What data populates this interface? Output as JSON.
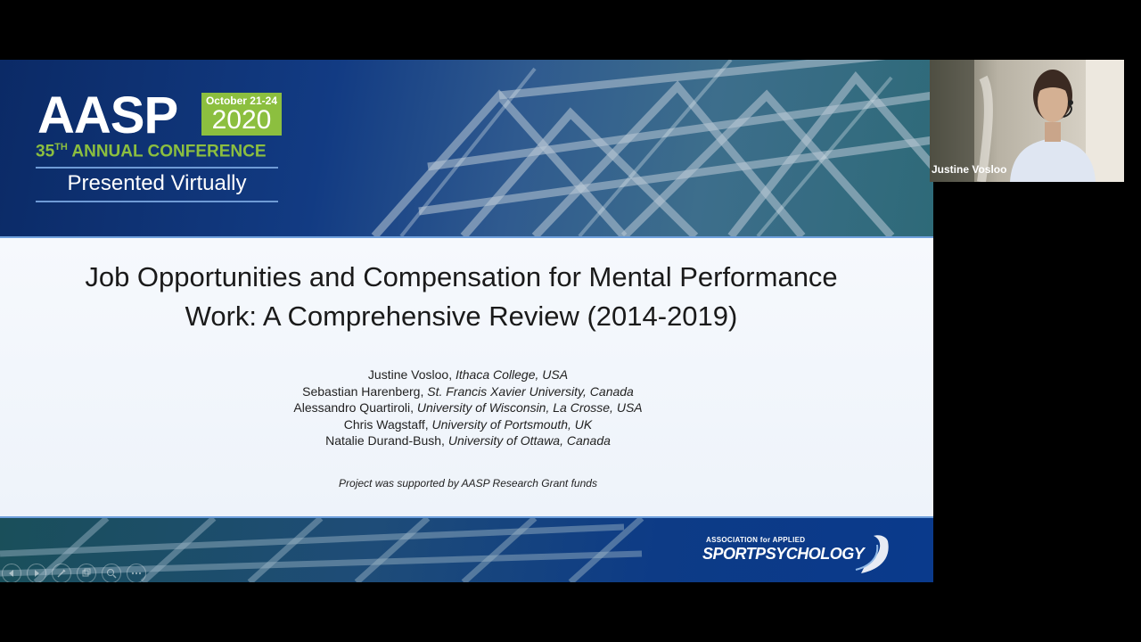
{
  "conference": {
    "org": "AASP",
    "dates": "October 21-24",
    "year": "2020",
    "ordinal_num": "35",
    "ordinal_suffix": "TH",
    "annual_conference": "ANNUAL CONFERENCE",
    "presented": "Presented Virtually"
  },
  "slide": {
    "title": "Job Opportunities and Compensation for Mental Performance\nWork: A Comprehensive Review (2014-2019)",
    "authors": [
      {
        "name": "Justine Vosloo,  ",
        "affiliation": "Ithaca College, USA"
      },
      {
        "name": "Sebastian Harenberg, ",
        "affiliation": "St. Francis Xavier University, Canada"
      },
      {
        "name": "Alessandro Quartiroli, ",
        "affiliation": "University of Wisconsin, La Crosse, USA"
      },
      {
        "name": "Chris Wagstaff, ",
        "affiliation": "University of Portsmouth, UK"
      },
      {
        "name": "Natalie Durand-Bush, ",
        "affiliation": "University of Ottawa, Canada"
      }
    ],
    "support_note": "Project was supported by AASP Research Grant funds"
  },
  "footer_logo": {
    "association": "ASSOCIATION for APPLIED",
    "name": "SPORTPSYCHOLOGY"
  },
  "participant": {
    "name": "Justine Vosloo"
  },
  "controls": [
    "previous-icon",
    "next-icon",
    "pen-icon",
    "slides-icon",
    "zoom-icon",
    "more-icon"
  ],
  "colors": {
    "brand_green": "#8cbf3f",
    "brand_blue": "#0b2a66",
    "accent_line": "#6fa0dc"
  }
}
